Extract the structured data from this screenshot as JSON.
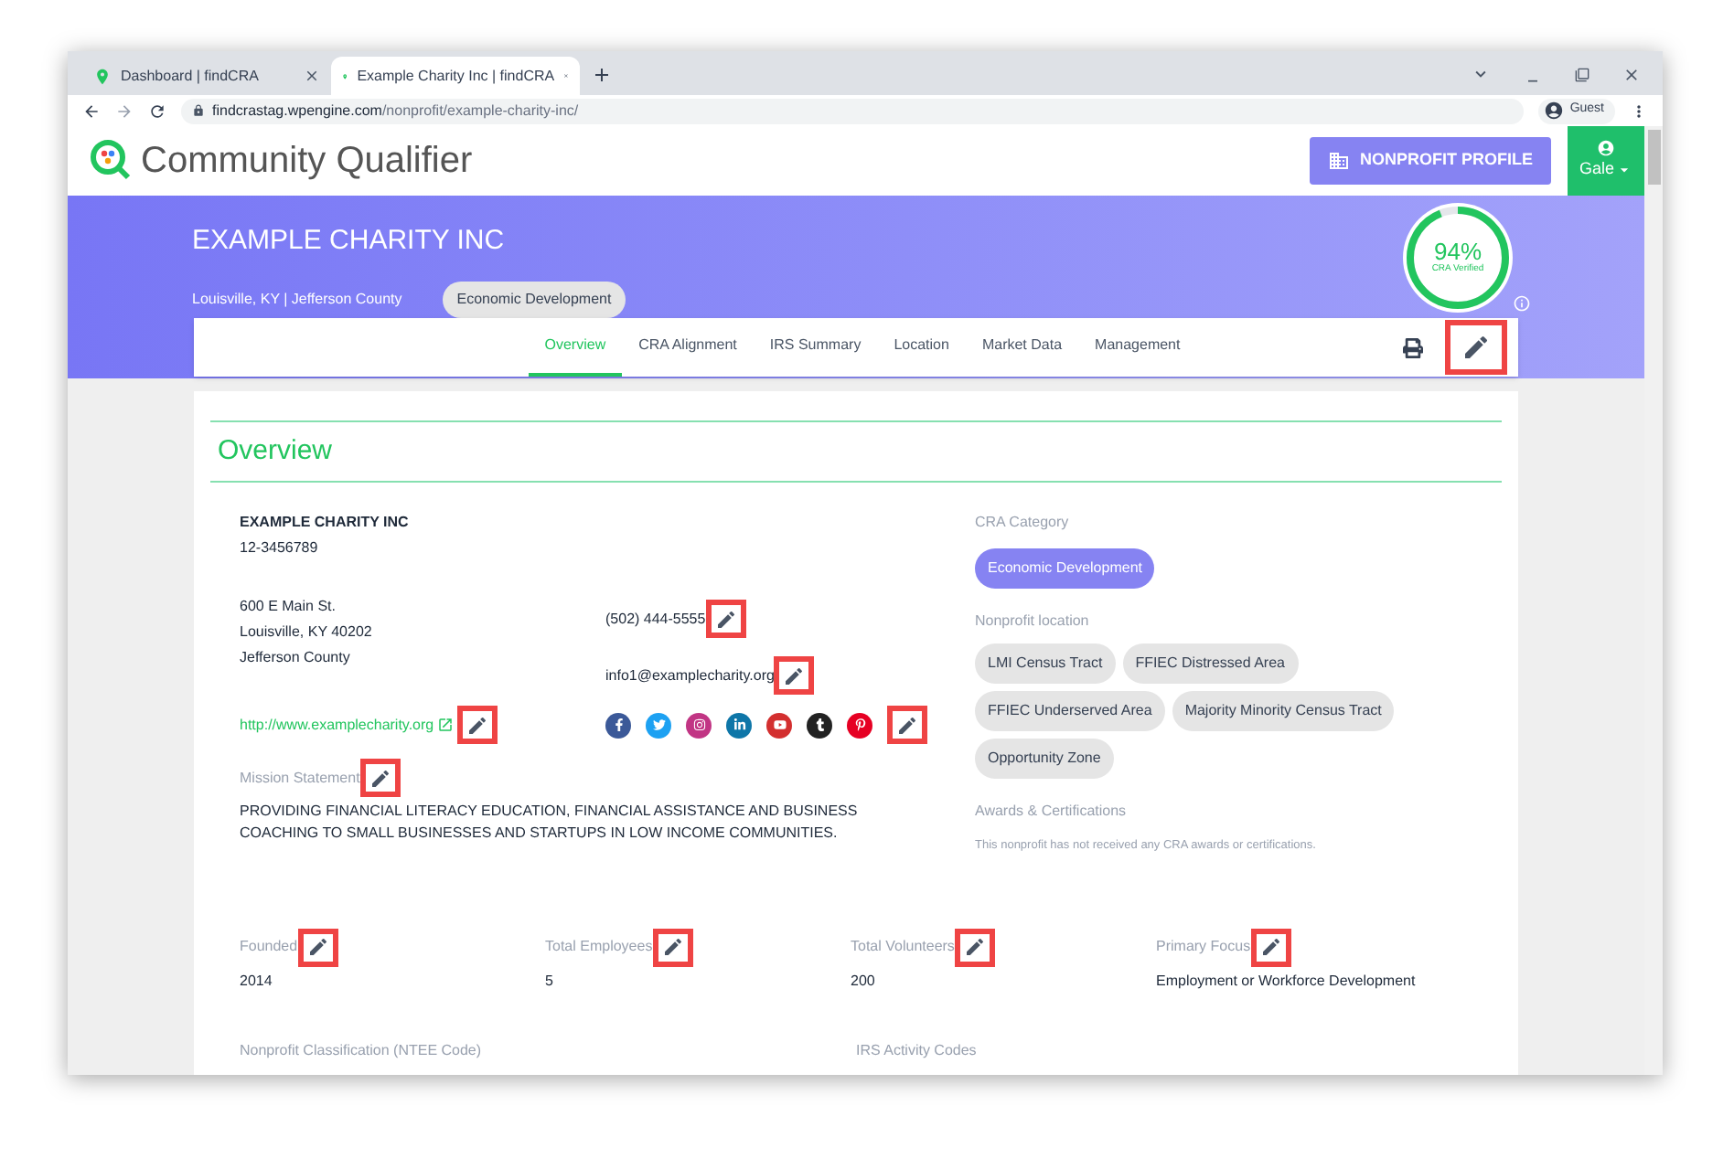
{
  "browser": {
    "tabs": [
      {
        "title": "Dashboard | findCRA",
        "selected": false
      },
      {
        "title": "Example Charity Inc | findCRA",
        "selected": true
      }
    ],
    "url_host": "findcrastag.wpengine.com",
    "url_path": "/nonprofit/example-charity-inc/",
    "profile": "Guest"
  },
  "header": {
    "app_name": "Community Qualifier",
    "profile_button": "NONPROFIT PROFILE",
    "user": "Gale"
  },
  "banner": {
    "title": "EXAMPLE CHARITY INC",
    "location": "Louisville, KY | Jefferson County",
    "category": "Economic Development",
    "score": {
      "value": "94%",
      "label": "CRA Verified",
      "level": 0.94
    }
  },
  "nav": [
    {
      "label": "Overview",
      "selected": true
    },
    {
      "label": "CRA Alignment",
      "selected": false
    },
    {
      "label": "IRS Summary",
      "selected": false
    },
    {
      "label": "Location",
      "selected": false
    },
    {
      "label": "Market Data",
      "selected": false
    },
    {
      "label": "Management",
      "selected": false
    }
  ],
  "overview": {
    "heading": "Overview",
    "name": "EXAMPLE CHARITY INC",
    "ein": "12-3456789",
    "address": [
      "600 E Main St.",
      "Louisville, KY 40202",
      "Jefferson County"
    ],
    "phone": "(502) 444-5555",
    "email": "info1@examplecharity.org",
    "website": "http://www.examplecharity.org",
    "mission_label": "Mission Statement",
    "mission": "PROVIDING FINANCIAL LITERACY EDUCATION, FINANCIAL ASSISTANCE AND BUSINESS COACHING TO SMALL BUSINESSES AND STARTUPS IN LOW INCOME COMMUNITIES.",
    "cra_category_label": "CRA Category",
    "cra_category": "Economic Development",
    "location_label": "Nonprofit location",
    "location_tags": [
      "LMI Census Tract",
      "FFIEC Distressed Area",
      "FFIEC Underserved Area",
      "Majority Minority Census Tract",
      "Opportunity Zone"
    ],
    "awards_label": "Awards & Certifications",
    "awards_text": "This nonprofit has not received any CRA awards or certifications.",
    "stats": [
      {
        "label": "Founded",
        "value": "2014"
      },
      {
        "label": "Total Employees",
        "value": "5"
      },
      {
        "label": "Total Volunteers",
        "value": "200"
      },
      {
        "label": "Primary Focus",
        "value": "Employment or Workforce Development"
      }
    ],
    "more_sections": [
      "Nonprofit Classification (NTEE Code)",
      "IRS Activity Codes"
    ]
  }
}
